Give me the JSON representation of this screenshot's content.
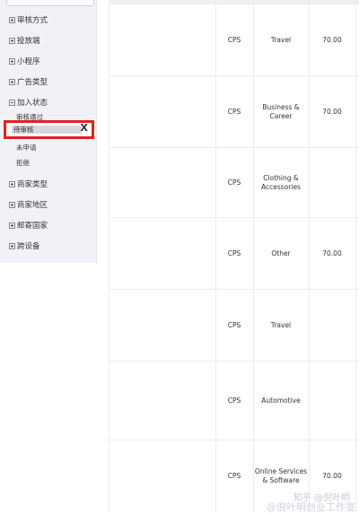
{
  "sidebar": {
    "groups": [
      {
        "label": "审核方式"
      },
      {
        "label": "投放端"
      },
      {
        "label": "小程序"
      },
      {
        "label": "广告类型"
      },
      {
        "label": "加入状态"
      },
      {
        "label": "商家类型"
      },
      {
        "label": "商家地区"
      },
      {
        "label": "邮寄国家"
      },
      {
        "label": "跨设备"
      }
    ],
    "join_status": {
      "items": [
        {
          "label": "审核通过"
        },
        {
          "label": "待审核"
        },
        {
          "label": "未申请"
        },
        {
          "label": "拒绝"
        }
      ],
      "selected": "待审核",
      "clear_label": "X"
    }
  },
  "table": {
    "rows": [
      {
        "type": "CPS",
        "category": "Travel",
        "amount": "70.00"
      },
      {
        "type": "CPS",
        "category": "Business & Career",
        "amount": "70.00"
      },
      {
        "type": "CPS",
        "category": "Clothing & Accessories",
        "amount": ""
      },
      {
        "type": "CPS",
        "category": "Other",
        "amount": "70.00"
      },
      {
        "type": "CPS",
        "category": "Travel",
        "amount": ""
      },
      {
        "type": "CPS",
        "category": "Automotive",
        "amount": ""
      },
      {
        "type": "CPS",
        "category": "Online Services & Software",
        "amount": "70.00"
      }
    ]
  },
  "watermark": {
    "line1": "知乎 @倪叶明",
    "line2": "@倪叶明创业工作室"
  }
}
